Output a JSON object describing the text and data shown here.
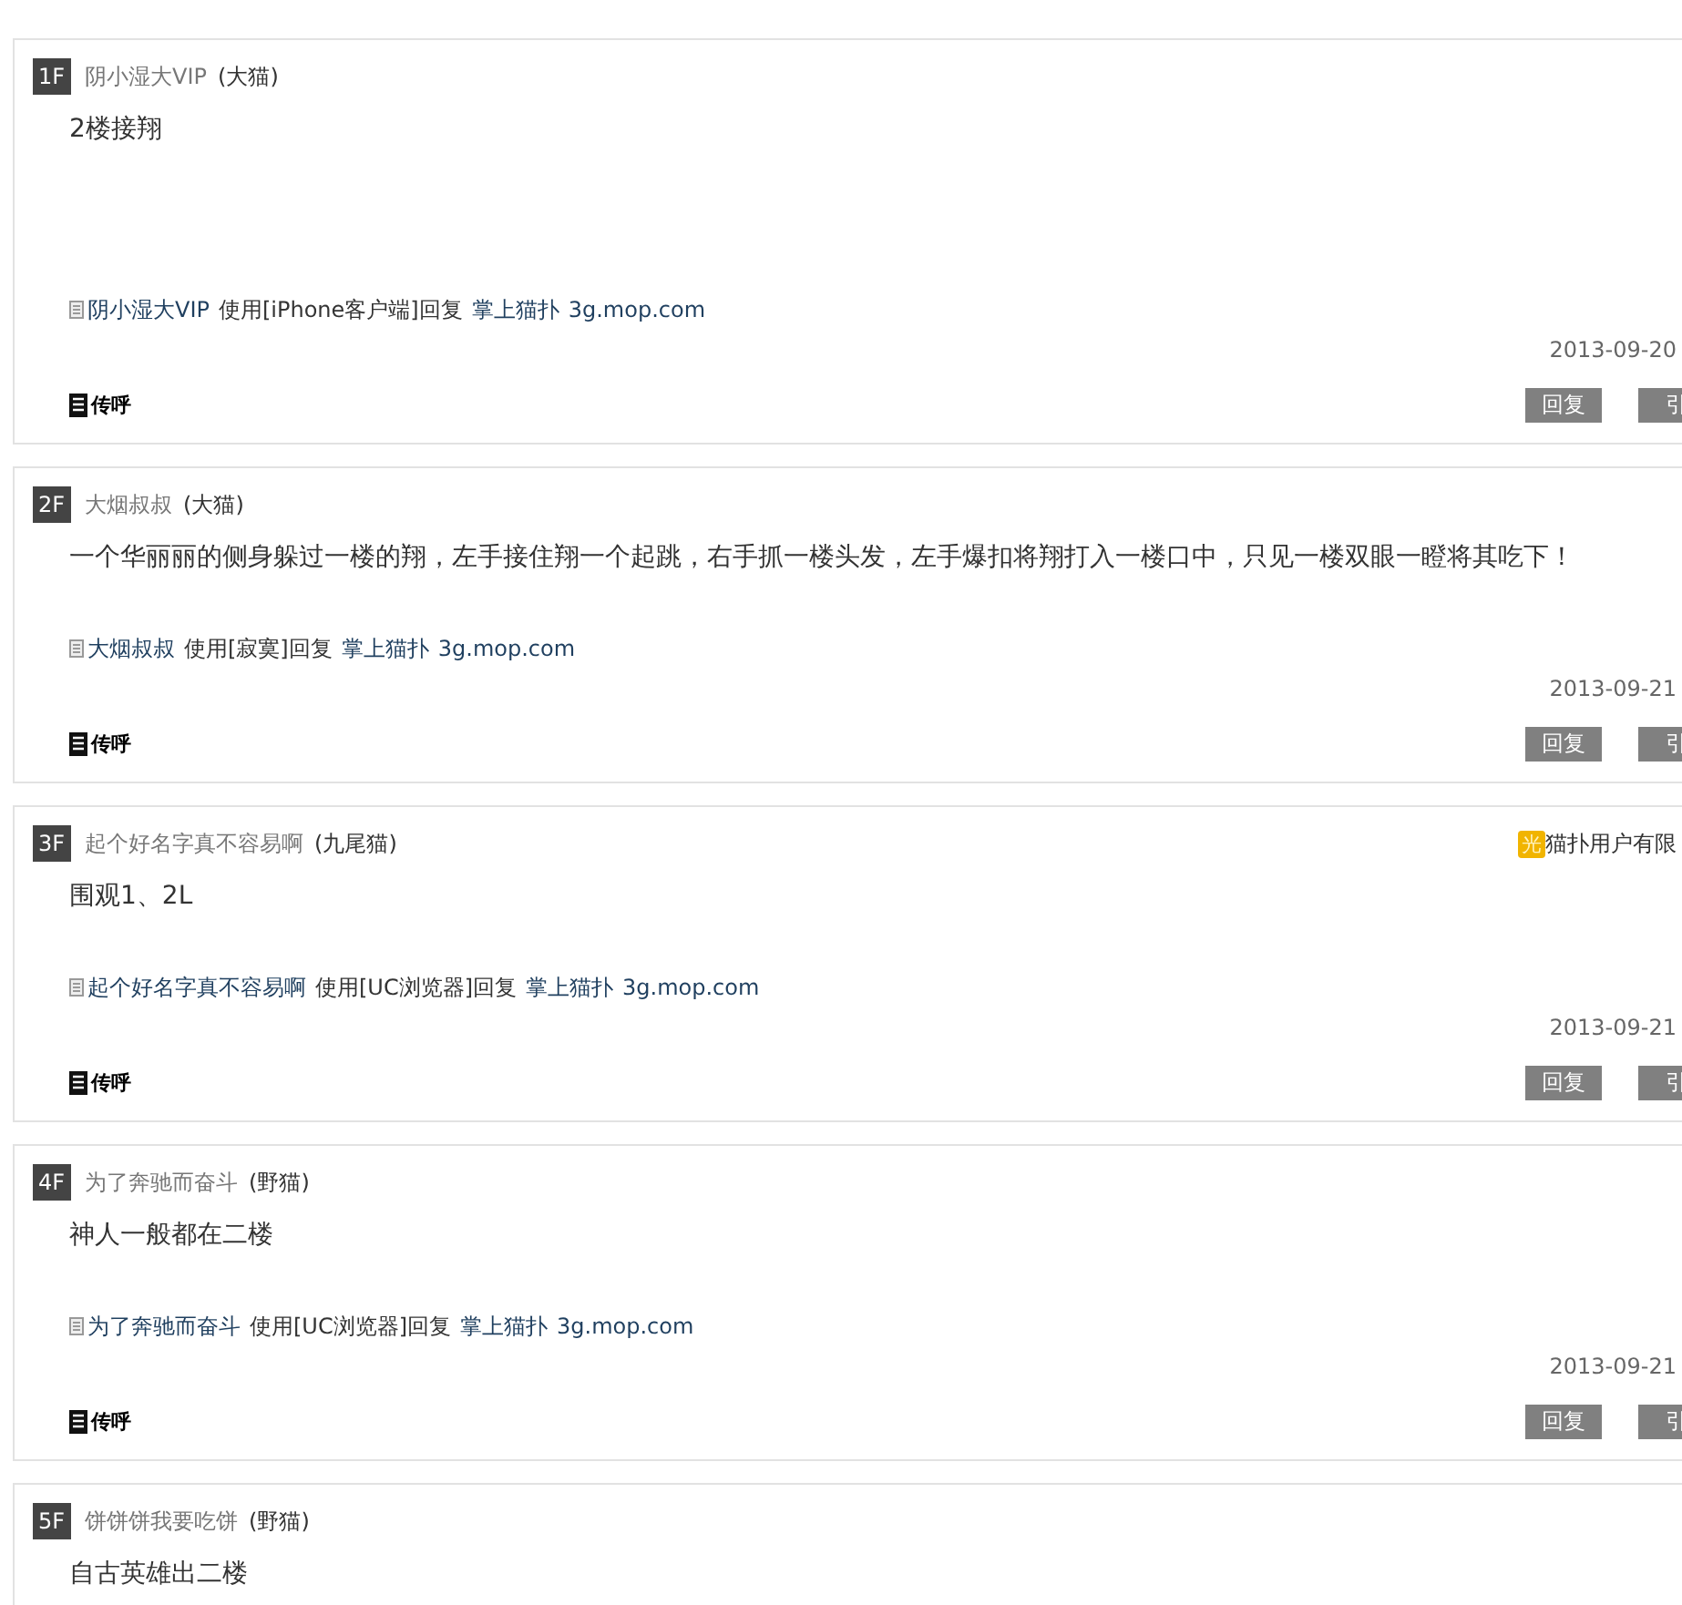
{
  "posts": [
    {
      "floor": "1F",
      "name": "阴小湿大VIP",
      "level": "(大猫)",
      "body": "2楼接翔",
      "source": {
        "user": "阴小湿大VIP",
        "text": "使用[iPhone客户端]回复",
        "site": "掌上猫扑",
        "url": "3g.mop.com"
      },
      "date": "2013-09-20",
      "pager": "传呼",
      "buttons": [
        "回复",
        "引"
      ]
    },
    {
      "floor": "2F",
      "name": "大烟叔叔",
      "level": "(大猫)",
      "body": "一个华丽丽的侧身躲过一楼的翔，左手接住翔一个起跳，右手抓一楼头发，左手爆扣将翔打入一楼口中，只见一楼双眼一瞪将其吃下！",
      "source": {
        "user": "大烟叔叔",
        "text": "使用[寂寞]回复",
        "site": "掌上猫扑",
        "url": "3g.mop.com"
      },
      "date": "2013-09-21",
      "pager": "传呼",
      "buttons": [
        "回复",
        "引"
      ]
    },
    {
      "floor": "3F",
      "name": "起个好名字真不容易啊",
      "level": "(九尾猫)",
      "badge": {
        "mark": "光",
        "text": "猫扑用户有限"
      },
      "body": "围观1、2L",
      "source": {
        "user": "起个好名字真不容易啊",
        "text": "使用[UC浏览器]回复",
        "site": "掌上猫扑",
        "url": "3g.mop.com"
      },
      "date": "2013-09-21",
      "pager": "传呼",
      "buttons": [
        "回复",
        "引"
      ]
    },
    {
      "floor": "4F",
      "name": "为了奔驰而奋斗",
      "level": "(野猫)",
      "body": "神人一般都在二楼",
      "source": {
        "user": "为了奔驰而奋斗",
        "text": "使用[UC浏览器]回复",
        "site": "掌上猫扑",
        "url": "3g.mop.com"
      },
      "date": "2013-09-21",
      "pager": "传呼",
      "buttons": [
        "回复",
        "引"
      ]
    },
    {
      "floor": "5F",
      "name": "饼饼饼我要吃饼",
      "level": "(野猫)",
      "body": "自古英雄出二楼"
    }
  ]
}
